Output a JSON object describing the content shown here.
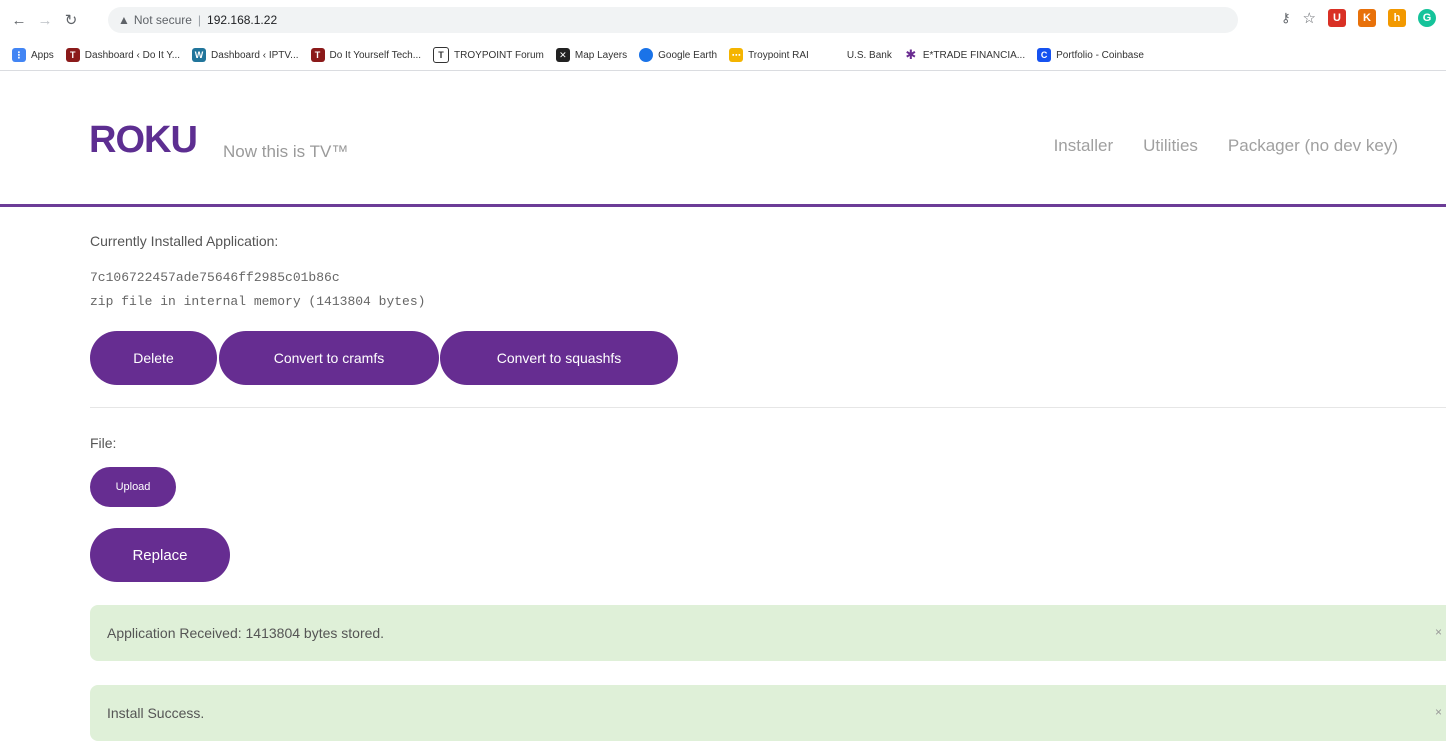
{
  "browser": {
    "address_warning": "Not secure",
    "url": "192.168.1.22",
    "bookmarks": [
      {
        "label": "Apps",
        "icon": "apps-grid-icon",
        "color": "#4285f4"
      },
      {
        "label": "Dashboard ‹ Do It Y...",
        "icon": "diy-favicon",
        "color": "#8b1a1a"
      },
      {
        "label": "Dashboard ‹ IPTV...",
        "icon": "wordpress-favicon",
        "color": "#21759b"
      },
      {
        "label": "Do It Yourself Tech...",
        "icon": "diy-favicon",
        "color": "#8b1a1a"
      },
      {
        "label": "TROYPOINT Forum",
        "icon": "troypoint-favicon",
        "color": "#333333"
      },
      {
        "label": "Map Layers",
        "icon": "map-layers-favicon",
        "color": "#222222"
      },
      {
        "label": "Google Earth",
        "icon": "google-earth-favicon",
        "color": "#1a73e8"
      },
      {
        "label": "Troypoint RAI",
        "icon": "troypoint-rai-favicon",
        "color": "#f4b400"
      },
      {
        "label": "U.S. Bank",
        "icon": "",
        "color": ""
      },
      {
        "label": "E*TRADE FINANCIA...",
        "icon": "etrade-favicon",
        "color": "#6a2c91"
      },
      {
        "label": "Portfolio - Coinbase",
        "icon": "coinbase-favicon",
        "color": "#1652f0"
      }
    ]
  },
  "header": {
    "logo": "ROKU",
    "tagline": "Now this is TV™",
    "nav": [
      "Installer",
      "Utilities",
      "Packager (no dev key)"
    ]
  },
  "installed": {
    "heading": "Currently Installed Application:",
    "app_id": "7c106722457ade75646ff2985c01b86c",
    "storage": "zip file in internal memory (1413804 bytes)",
    "buttons": {
      "delete": "Delete",
      "cramfs": "Convert to cramfs",
      "squashfs": "Convert to squashfs"
    }
  },
  "upload": {
    "file_label": "File:",
    "upload_label": "Upload",
    "replace_label": "Replace"
  },
  "messages": [
    "Application Received: 1413804 bytes stored.",
    "Install Success."
  ],
  "colors": {
    "brand": "#662d91",
    "success_bg": "#dff0d8"
  }
}
